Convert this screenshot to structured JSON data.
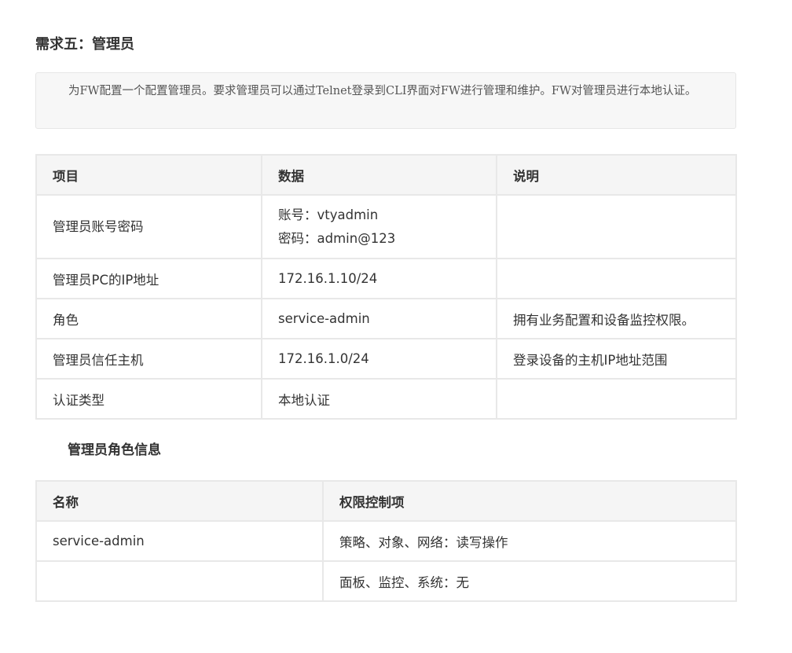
{
  "heading": "需求五：管理员",
  "quote": "为FW配置一个配置管理员。要求管理员可以通过Telnet登录到CLI界面对FW进行管理和维护。FW对管理员进行本地认证。",
  "table1": {
    "headers": [
      "项目",
      "数据",
      "说明"
    ],
    "rows": [
      {
        "item": "管理员账号密码",
        "data_line1": "账号：vtyadmin",
        "data_line2": "密码：admin@123",
        "note": ""
      },
      {
        "item": "管理员PC的IP地址",
        "data": "172.16.1.10/24",
        "note": ""
      },
      {
        "item": "角色",
        "data": "service-admin",
        "note": "拥有业务配置和设备监控权限。"
      },
      {
        "item": "管理员信任主机",
        "data": "172.16.1.0/24",
        "note": "登录设备的主机IP地址范围"
      },
      {
        "item": "认证类型",
        "data": "本地认证",
        "note": ""
      }
    ]
  },
  "sub_heading": "管理员角色信息",
  "table2": {
    "headers": [
      "名称",
      "权限控制项"
    ],
    "rows": [
      {
        "name": "service-admin",
        "perm": "策略、对象、网络：读写操作"
      },
      {
        "name": "",
        "perm": "面板、监控、系统：无"
      }
    ]
  }
}
